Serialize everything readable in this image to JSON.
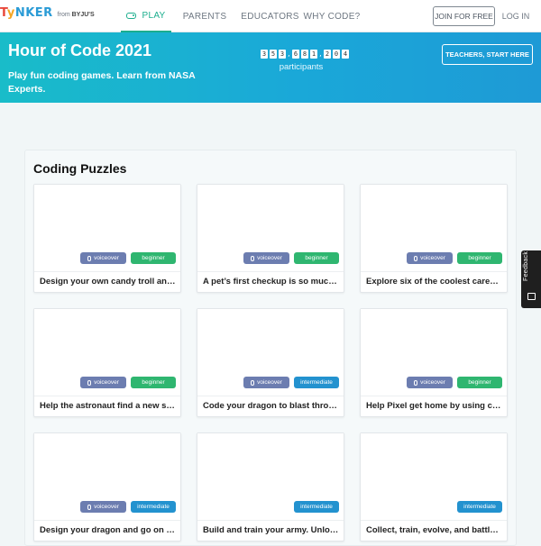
{
  "nav": {
    "logo": {
      "part1": "T",
      "part2": "y",
      "part3": "NKER",
      "from": "from",
      "brand": "BYJU'S"
    },
    "links": [
      {
        "label": "PLAY",
        "icon": "gamepad-icon",
        "active": true
      },
      {
        "label": "PARENTS"
      },
      {
        "label": "EDUCATORS"
      },
      {
        "label": "WHY CODE?"
      }
    ],
    "join_label": "JOIN FOR FREE",
    "login_label": "LOG IN"
  },
  "hero": {
    "title": "Hour of Code 2021",
    "subtitle": "Play fun coding games. Learn from NASA Experts.",
    "counter_digits": [
      "3",
      "5",
      "3",
      ",",
      "6",
      "8",
      "1",
      ",",
      "2",
      "0",
      "4"
    ],
    "counter_label": "participants",
    "teacher_label": "TEACHERS, START HERE"
  },
  "section": {
    "title": "Coding Puzzles"
  },
  "cards": [
    {
      "caption": "Design your own candy troll and make...",
      "voiceover": true,
      "level": "beginner"
    },
    {
      "caption": "A pet’s first checkup is so much fun!",
      "voiceover": true,
      "level": "beginner"
    },
    {
      "caption": "Explore six of the coolest careers in...",
      "voiceover": true,
      "level": "beginner"
    },
    {
      "caption": "Help the astronaut find a new ship...",
      "voiceover": true,
      "level": "beginner"
    },
    {
      "caption": "Code your dragon to blast through...",
      "voiceover": true,
      "level": "intermediate"
    },
    {
      "caption": "Help Pixel get home by using code...",
      "voiceover": true,
      "level": "beginner"
    },
    {
      "caption": "Design your dragon and go on an adventure",
      "voiceover": true,
      "level": "intermediate"
    },
    {
      "caption": "Build and train your army. Unlock...",
      "voiceover": false,
      "level": "intermediate"
    },
    {
      "caption": "Collect, train, evolve, and battle monsters",
      "voiceover": false,
      "level": "intermediate"
    }
  ],
  "badge_labels": {
    "voiceover": "voiceover",
    "beginner": "beginner",
    "intermediate": "intermediate"
  },
  "feedback_label": "Feedback",
  "colors": {
    "accent": "#1cae8e",
    "hero": "#1aa8d8",
    "beginner": "#2fb670",
    "intermediate": "#2392cf",
    "voiceover": "#6c7db0"
  }
}
